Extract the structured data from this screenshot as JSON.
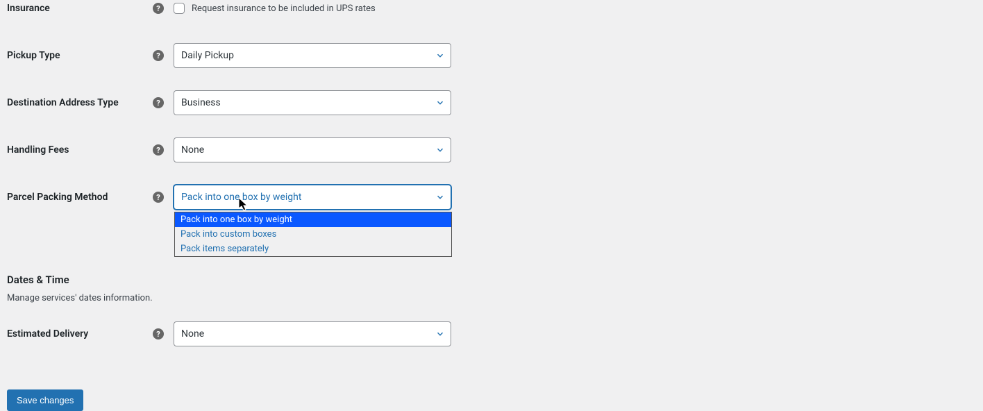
{
  "insurance": {
    "label": "Insurance",
    "checkbox_label": "Request insurance to be included in UPS rates"
  },
  "pickup_type": {
    "label": "Pickup Type",
    "value": "Daily Pickup"
  },
  "destination_address_type": {
    "label": "Destination Address Type",
    "value": "Business"
  },
  "handling_fees": {
    "label": "Handling Fees",
    "value": "None"
  },
  "parcel_packing": {
    "label": "Parcel Packing Method",
    "value": "Pack into one box by weight",
    "options": [
      "Pack into one box by weight",
      "Pack into custom boxes",
      "Pack items separately"
    ]
  },
  "dates_time": {
    "heading": "Dates & Time",
    "desc": "Manage services' dates information."
  },
  "estimated_delivery": {
    "label": "Estimated Delivery",
    "value": "None"
  },
  "save_button": "Save changes"
}
